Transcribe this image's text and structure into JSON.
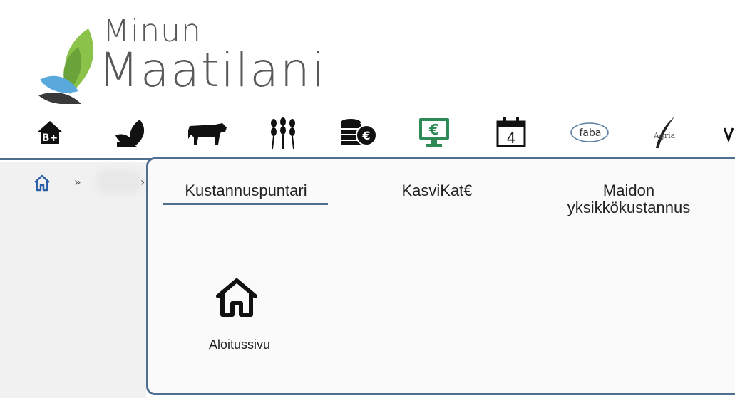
{
  "logo": {
    "line1": "Minun",
    "line2": "Maatilani",
    "colors": {
      "text": "#595959",
      "green": "#8bc34a",
      "blue": "#5aa9dd",
      "dark": "#333333"
    }
  },
  "iconbar": {
    "icons": [
      {
        "name": "farm-bplus-icon",
        "label": "B+"
      },
      {
        "name": "leaves-icon"
      },
      {
        "name": "cow-icon"
      },
      {
        "name": "wheat-icon"
      },
      {
        "name": "coins-euro-icon"
      },
      {
        "name": "monitor-euro-icon",
        "label": "€"
      },
      {
        "name": "calendar-icon",
        "label": "4"
      },
      {
        "name": "faba-logo-icon",
        "label": "faba"
      },
      {
        "name": "agria-logo-icon",
        "label": "Agria"
      }
    ]
  },
  "breadcrumb": {
    "separator": "»",
    "separator2": "›"
  },
  "tabs": [
    {
      "label": "Kustannuspuntari",
      "active": true
    },
    {
      "label": "KasviKat€",
      "active": false
    },
    {
      "label": "Maidon yksikkökustannus",
      "active": false
    }
  ],
  "tile": {
    "label": "Aloitussivu",
    "icon": "home-icon"
  },
  "colors": {
    "accent": "#4f6f8f",
    "sidebar_bg": "#f1f1f1",
    "panel_bg": "#fafafa"
  }
}
